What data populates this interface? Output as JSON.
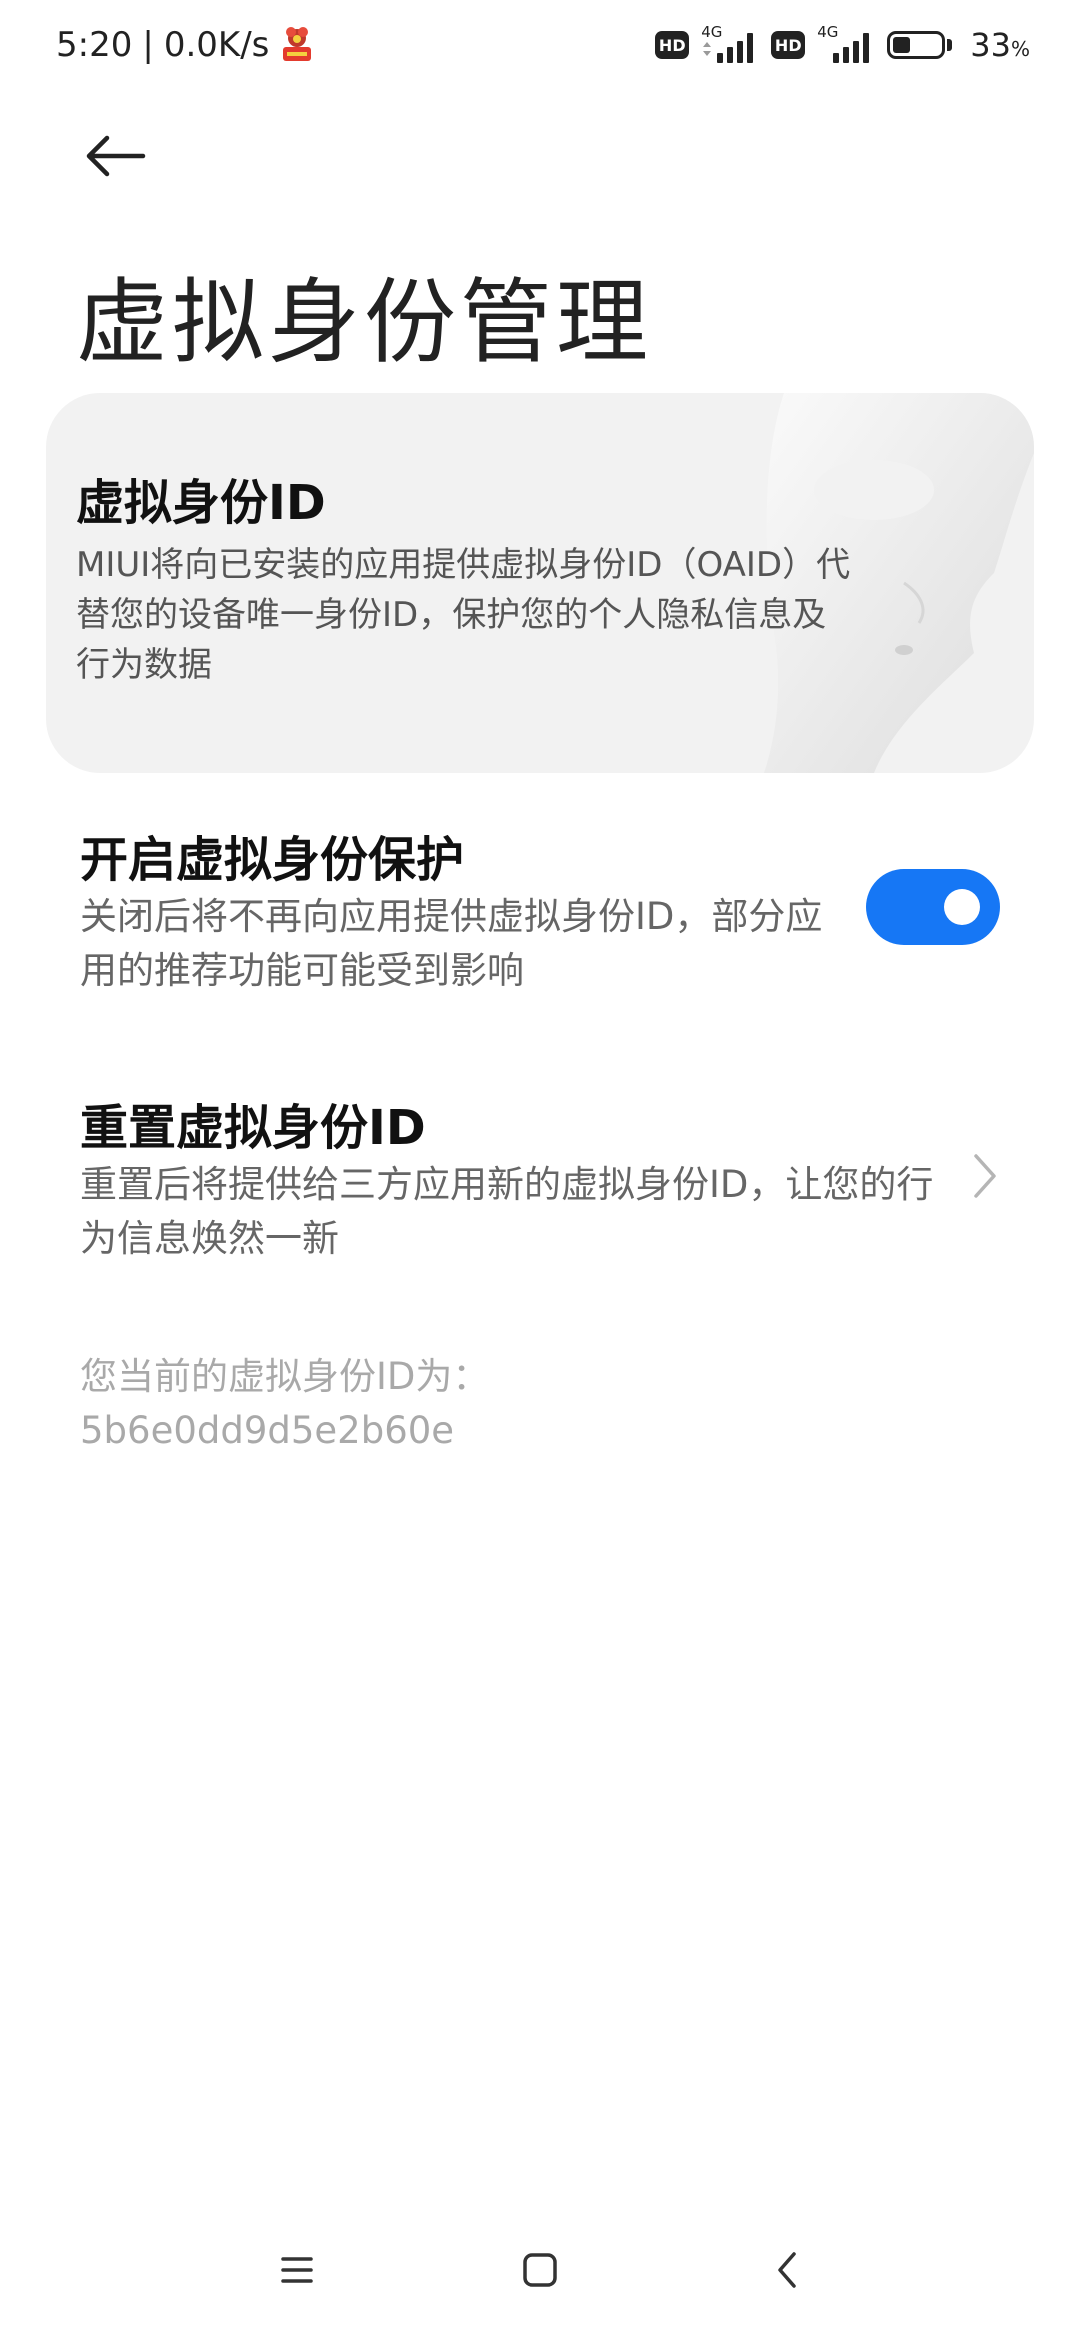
{
  "status_bar": {
    "time": "5:20",
    "separator": "|",
    "net_speed": "0.0K/s",
    "app_icon": "red-app-notification-icon",
    "hd_label": "HD",
    "network_label": "4G",
    "battery_percent": "33",
    "battery_unit": "%",
    "battery_level": 0.33
  },
  "header": {
    "back_icon": "arrow-left-icon",
    "title": "虚拟身份管理"
  },
  "info_card": {
    "title": "虚拟身份ID",
    "description": "MIUI将向已安装的应用提供虚拟身份ID（OAID）代替您的设备唯一身份ID，保护您的个人隐私信息及行为数据",
    "image": "mask-icon"
  },
  "settings": {
    "protection": {
      "title": "开启虚拟身份保护",
      "description": "关闭后将不再向应用提供虚拟身份ID，部分应用的推荐功能可能受到影响",
      "enabled": true
    },
    "reset": {
      "title": "重置虚拟身份ID",
      "description": "重置后将提供给三方应用新的虚拟身份ID，让您的行为信息焕然一新",
      "icon": "chevron-right-icon"
    }
  },
  "current_id": {
    "label": "您当前的虚拟身份ID为：",
    "value": "5b6e0dd9d5e2b60e"
  },
  "nav_bar": {
    "menu_icon": "menu-icon",
    "home_icon": "home-square-icon",
    "back_icon": "chevron-left-icon"
  },
  "colors": {
    "accent": "#1677f5",
    "card_background": "#f2f2f2",
    "muted_text": "#a9a9a9"
  }
}
